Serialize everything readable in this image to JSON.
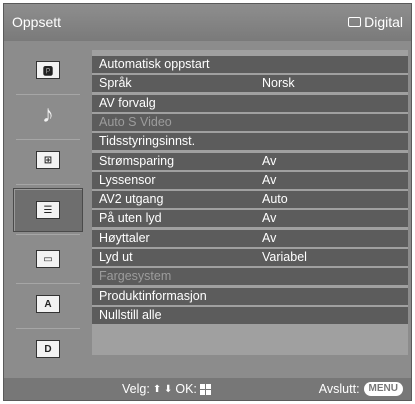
{
  "header": {
    "title": "Oppsett",
    "source_label": "Digital",
    "source_icon": "screen-outline-icon"
  },
  "sidebar": {
    "items": [
      {
        "name": "picture",
        "icon": "picture-icon",
        "glyph": "🅿",
        "selected": false
      },
      {
        "name": "sound",
        "icon": "music-note-icon",
        "glyph": "♪",
        "selected": false
      },
      {
        "name": "screen",
        "icon": "screen-control-icon",
        "glyph": "⊞",
        "selected": false
      },
      {
        "name": "setup",
        "icon": "setup-list-icon",
        "glyph": "☰",
        "selected": true
      },
      {
        "name": "pc",
        "icon": "monitor-icon",
        "glyph": "▭",
        "selected": false
      },
      {
        "name": "analog",
        "icon": "analog-tuning-icon",
        "glyph": "A",
        "selected": false
      },
      {
        "name": "digital",
        "icon": "digital-tuning-icon",
        "glyph": "D",
        "selected": false
      }
    ]
  },
  "menu": {
    "rows": [
      {
        "label": "Automatisk oppstart",
        "value": "",
        "disabled": false
      },
      {
        "label": "Språk",
        "value": "Norsk",
        "disabled": false
      },
      {
        "label": "AV forvalg",
        "value": "",
        "disabled": false
      },
      {
        "label": "Auto S Video",
        "value": "",
        "disabled": true
      },
      {
        "label": "Tidsstyringsinnst.",
        "value": "",
        "disabled": false
      },
      {
        "label": "Strømsparing",
        "value": "Av",
        "disabled": false
      },
      {
        "label": "Lyssensor",
        "value": "Av",
        "disabled": false
      },
      {
        "label": "AV2 utgang",
        "value": "Auto",
        "disabled": false
      },
      {
        "label": "På uten lyd",
        "value": "Av",
        "disabled": false
      },
      {
        "label": "Høyttaler",
        "value": "Av",
        "disabled": false
      },
      {
        "label": "Lyd ut",
        "value": "Variabel",
        "disabled": false
      },
      {
        "label": "Fargesystem",
        "value": "",
        "disabled": true
      },
      {
        "label": "Produktinformasjon",
        "value": "",
        "disabled": false
      },
      {
        "label": "Nullstill alle",
        "value": "",
        "disabled": false
      }
    ]
  },
  "footer": {
    "select_label": "Velg:",
    "arrows": "⬆ ⬇",
    "ok_label": "OK:",
    "exit_label": "Avslutt:",
    "menu_button": "MENU"
  },
  "colors": {
    "background": "#8c8c8c",
    "row": "#5c5c5c",
    "row_text": "#ffffff",
    "disabled_text": "#9c9c9c"
  }
}
